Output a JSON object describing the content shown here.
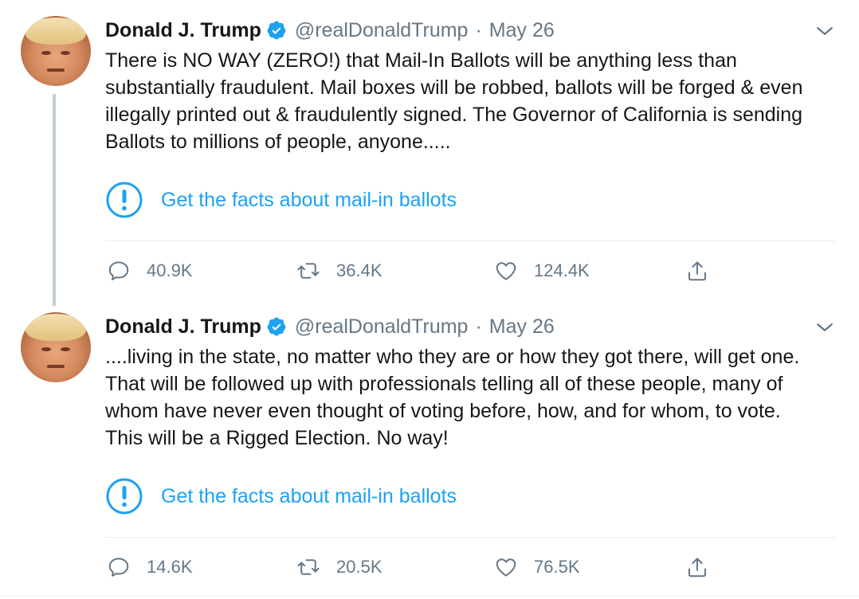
{
  "tweets": [
    {
      "author_name": "Donald J. Trump",
      "handle": "@realDonaldTrump",
      "separator": "·",
      "date": "May 26",
      "text": "There is NO WAY (ZERO!) that Mail-In Ballots will be anything less than substantially fraudulent. Mail boxes will be robbed, ballots will be forged & even illegally printed out & fraudulently signed. The Governor of California is sending Ballots to millions of people, anyone.....",
      "facts_link": "Get the facts about mail-in ballots",
      "replies": "40.9K",
      "retweets": "36.4K",
      "likes": "124.4K"
    },
    {
      "author_name": "Donald J. Trump",
      "handle": "@realDonaldTrump",
      "separator": "·",
      "date": "May 26",
      "text": "....living in the state, no matter who they are or how they got there, will get one. That will be followed up with professionals telling all of these people, many of whom have never even thought of voting before, how, and for whom, to vote. This will be a Rigged Election. No way!",
      "facts_link": "Get the facts about mail-in ballots",
      "replies": "14.6K",
      "retweets": "20.5K",
      "likes": "76.5K"
    }
  ],
  "colors": {
    "accent": "#1da1f2",
    "secondary_text": "#657786",
    "primary_text": "#14171a",
    "divider": "#e6ecf0",
    "thread_line": "#c4cfd6"
  },
  "icons": [
    "verified-badge-icon",
    "chevron-down-icon",
    "exclamation-circle-icon",
    "reply-icon",
    "retweet-icon",
    "like-icon",
    "share-icon"
  ]
}
